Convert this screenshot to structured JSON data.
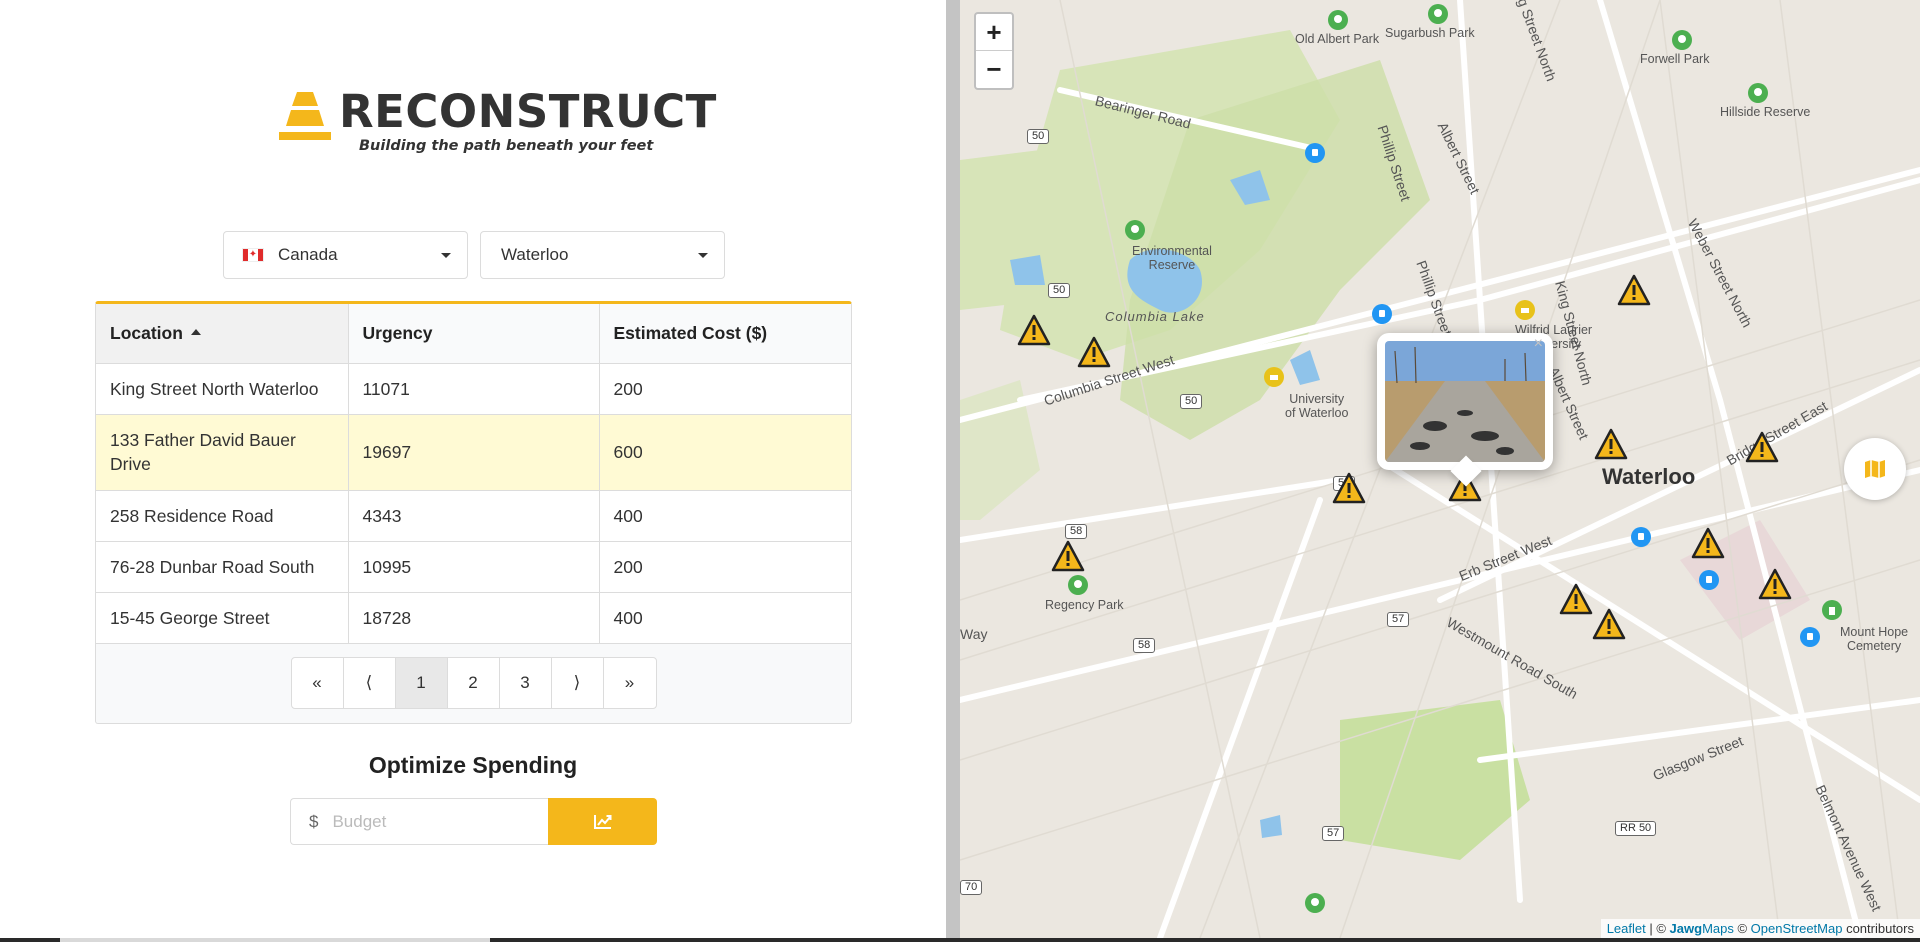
{
  "app": {
    "brand": "RECONSTRUCT",
    "tagline": "Building the path beneath your feet"
  },
  "filters": {
    "country": "Canada",
    "city": "Waterloo"
  },
  "table": {
    "headers": {
      "location": "Location",
      "urgency": "Urgency",
      "cost": "Estimated Cost ($)"
    },
    "rows": [
      {
        "location": "King Street North Waterloo",
        "urgency": "11071",
        "cost": "200"
      },
      {
        "location": "133 Father David Bauer Drive",
        "urgency": "19697",
        "cost": "600"
      },
      {
        "location": "258 Residence Road",
        "urgency": "4343",
        "cost": "400"
      },
      {
        "location": "76-28 Dunbar Road South",
        "urgency": "10995",
        "cost": "200"
      },
      {
        "location": "15-45 George Street",
        "urgency": "18728",
        "cost": "400"
      }
    ]
  },
  "pagination": {
    "first": "«",
    "prev": "⟨",
    "pages": [
      "1",
      "2",
      "3"
    ],
    "next": "⟩",
    "last": "»"
  },
  "optimize": {
    "title": "Optimize Spending",
    "currency": "$",
    "placeholder": "Budget"
  },
  "map": {
    "zoom_in": "+",
    "zoom_out": "−",
    "city_label": "Waterloo",
    "attribution_leaflet": "Leaflet",
    "attribution_sep": " | © ",
    "attribution_jawg_bold": "Jawg",
    "attribution_jawg": "Maps",
    "attribution_osm_prefix": " © ",
    "attribution_osm": "OpenStreetMap",
    "attribution_suffix": " contributors",
    "places": {
      "old_albert_park": "Old Albert Park",
      "sugarbush_park": "Sugarbush Park",
      "forwell_park": "Forwell Park",
      "hillside_reserve": "Hillside Reserve",
      "environmental_reserve_1": "Environmental",
      "environmental_reserve_2": "Reserve",
      "columbia_lake": "Columbia Lake",
      "wilfrid_1": "Wilfrid Laurier",
      "wilfrid_2": "University",
      "uw_1": "University",
      "uw_2": "of Waterloo",
      "regency_park": "Regency Park",
      "mount_hope_1": "Mount Hope",
      "mount_hope_2": "Cemetery"
    },
    "roads": {
      "bearinger": "Bearinger Road",
      "phillip1": "Phillip Street",
      "albert1": "Albert Street",
      "phillip2": "Phillip Street",
      "king_north1": "King Street North",
      "weber": "Weber Street North",
      "king_north2": "King Street North",
      "columbia": "Columbia Street West",
      "albert2": "Albert Street",
      "bridge_east": "Bridge Street East",
      "erb": "Erb Street West",
      "westmount": "Westmount Road South",
      "glasgow": "Glasgow Street",
      "belmont": "Belmont Avenue West",
      "way": "Way"
    },
    "shields": [
      "50",
      "50",
      "50",
      "50",
      "58",
      "58",
      "57",
      "57",
      "RR 50",
      "70"
    ]
  },
  "colors": {
    "accent": "#f4b71b",
    "highlight_row": "#fffad4",
    "warning_marker": "#f4b71b"
  }
}
